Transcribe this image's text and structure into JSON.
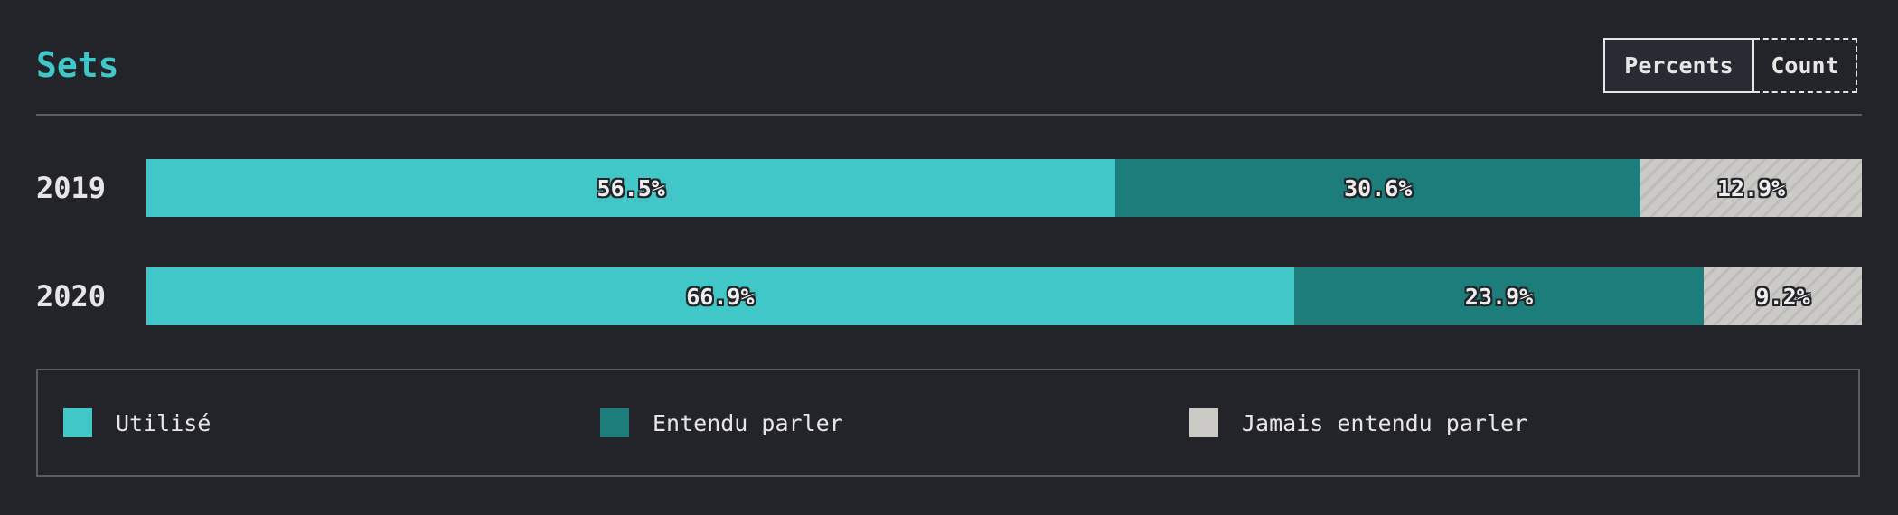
{
  "chart_data": {
    "type": "bar",
    "orientation": "horizontal",
    "stacked": true,
    "title": "Sets",
    "categories": [
      "2019",
      "2020"
    ],
    "series": [
      {
        "name": "Utilisé",
        "color": "#41c7c7",
        "values": [
          56.5,
          66.9
        ],
        "labels": [
          "56.5%",
          "66.9%"
        ]
      },
      {
        "name": "Entendu parler",
        "color": "#1d7d7b",
        "values": [
          30.6,
          23.9
        ],
        "labels": [
          "30.6%",
          "23.9%"
        ]
      },
      {
        "name": "Jamais entendu parler",
        "color": "#cbcac7",
        "values": [
          12.9,
          9.2
        ],
        "labels": [
          "12.9%",
          "9.2%"
        ]
      }
    ],
    "xlim": [
      0,
      100
    ],
    "legend_position": "bottom"
  },
  "toggle": {
    "percents_label": "Percents",
    "count_label": "Count",
    "selected": "Percents"
  }
}
